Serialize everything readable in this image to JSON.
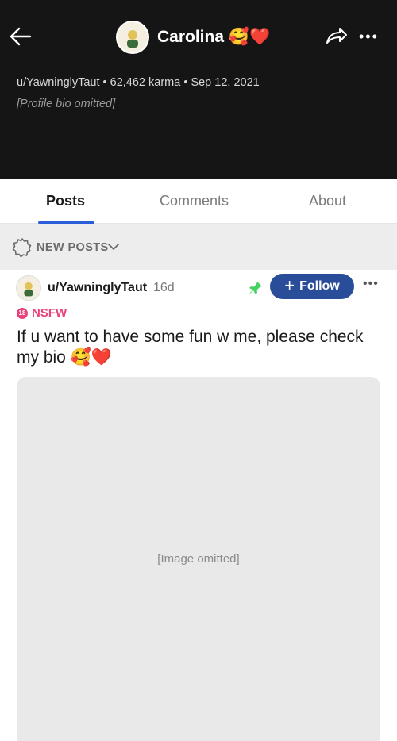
{
  "header": {
    "title": "Carolina 🥰❤️",
    "meta": "u/YawninglyTaut • 62,462 karma • Sep 12, 2021",
    "bio_omitted_note": "[Profile bio omitted]"
  },
  "tabs": [
    {
      "label": "Posts",
      "active": true
    },
    {
      "label": "Comments",
      "active": false
    },
    {
      "label": "About",
      "active": false
    }
  ],
  "sort": {
    "label": "NEW POSTS"
  },
  "post": {
    "author": "u/YawninglyTaut",
    "age": "16d",
    "follow_label": "Follow",
    "nsfw_badge": "18",
    "nsfw_label": "NSFW",
    "title": "If u want to have some fun w me, please check my bio 🥰❤️",
    "media_note": "[Image omitted]"
  },
  "colors": {
    "accent": "#2a5dd9",
    "follow_bg": "#2a4d9a",
    "nsfw": "#e8417c",
    "pin": "#46d160"
  }
}
